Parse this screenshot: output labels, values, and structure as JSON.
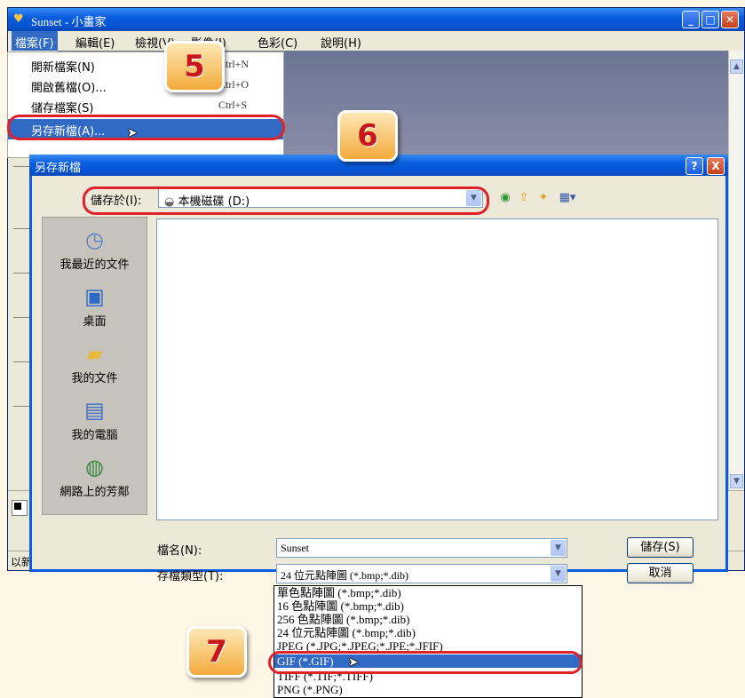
{
  "paint": {
    "title": "Sunset - 小畫家",
    "menus": [
      "檔案(F)",
      "編輯(E)",
      "檢視(V)",
      "影像(I)",
      "色彩(C)",
      "說明(H)"
    ],
    "status_text": "以新"
  },
  "file_menu": {
    "items": [
      {
        "label": "開新檔案(N)",
        "shortcut": "Ctrl+N"
      },
      {
        "label": "開啟舊檔(O)...",
        "shortcut": "Ctrl+O"
      },
      {
        "label": "儲存檔案(S)",
        "shortcut": "Ctrl+S"
      },
      {
        "label": "另存新檔(A)...",
        "shortcut": ""
      }
    ]
  },
  "dialog": {
    "title": "另存新檔",
    "lookin_label": "儲存於(I):",
    "lookin_value": "本機磁碟 (D:)",
    "places": [
      {
        "label": "我最近的文件",
        "icon": "recent-docs-icon"
      },
      {
        "label": "桌面",
        "icon": "desktop-icon"
      },
      {
        "label": "我的文件",
        "icon": "my-documents-icon"
      },
      {
        "label": "我的電腦",
        "icon": "my-computer-icon"
      },
      {
        "label": "網路上的芳鄰",
        "icon": "network-places-icon"
      }
    ],
    "filename_label": "檔名(N):",
    "filename_value": "Sunset",
    "filetype_label": "存檔類型(T):",
    "filetype_value": "24 位元點陣圖 (*.bmp;*.dib)",
    "save_button": "儲存(S)",
    "cancel_button": "取消",
    "help_button": "?",
    "close_button": "X"
  },
  "file_types": [
    "單色點陣圖 (*.bmp;*.dib)",
    "16 色點陣圖 (*.bmp;*.dib)",
    "256 色點陣圖 (*.bmp;*.dib)",
    "24 位元點陣圖 (*.bmp;*.dib)",
    "JPEG (*.JPG;*.JPEG;*.JPE;*.JFIF)",
    "GIF (*.GIF)",
    "TIFF (*.TIF;*.TIFF)",
    "PNG (*.PNG)"
  ],
  "steps": {
    "step5": "5",
    "step6": "6",
    "step7": "7"
  },
  "colors": {
    "xp_blue": "#0a5ddf",
    "highlight": "#316ac5",
    "annotation_red": "#e0212a",
    "badge_orange": "#f8c46c"
  }
}
